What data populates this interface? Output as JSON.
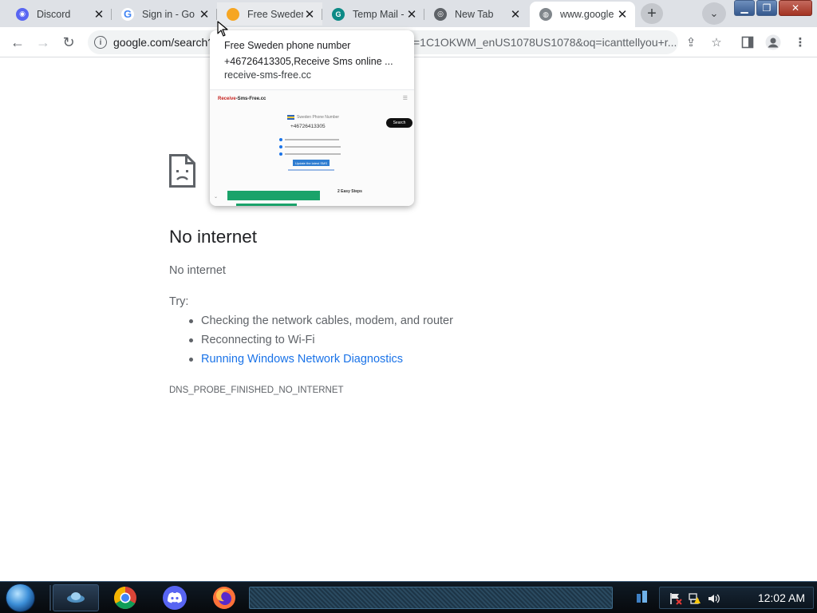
{
  "browser": {
    "tabs": [
      {
        "title": "Discord",
        "favicon": "discord-icon",
        "color": "#5865f2"
      },
      {
        "title": "Sign in - Go",
        "favicon": "google-icon",
        "color": "#4285f4"
      },
      {
        "title": "Free Sweden",
        "favicon": "sms-site-icon",
        "color": "#f6a623"
      },
      {
        "title": "Temp Mail -",
        "favicon": "temp-mail-icon",
        "color": "#0c8a86"
      },
      {
        "title": "New Tab",
        "favicon": "chrome-icon",
        "color": "#5f6368"
      },
      {
        "title": "www.google",
        "favicon": "globe-icon",
        "color": "#5f6368"
      }
    ],
    "active_tab_index": 5,
    "address_visible": "google.com/search?",
    "address_tail": "=1C1OKWM_enUS1078US1078&oq=icanttellyou+r...",
    "hovercard": {
      "title": "Free Sweden phone number +46726413305,Receive Sms online ...",
      "domain": "receive-sms-free.cc",
      "thumbnail": {
        "logo_prefix": "Receive",
        "logo_rest": "-Sms-Free.cc",
        "heading": "Sweden Phone Number",
        "number": "+46726413305",
        "search_label": "Search",
        "button_label": "Update the latest SMS",
        "steps_label": "2 Easy Steps"
      }
    }
  },
  "error_page": {
    "title": "No internet",
    "subtitle": "No internet",
    "try_label": "Try:",
    "suggestions": [
      "Checking the network cables, modem, and router",
      "Reconnecting to Wi-Fi",
      "Running Windows Network Diagnostics"
    ],
    "error_code": "DNS_PROBE_FINISHED_NO_INTERNET"
  },
  "taskbar": {
    "clock": "12:02 AM",
    "apps": [
      "app-icon",
      "chrome-icon",
      "discord-icon",
      "firefox-icon"
    ]
  }
}
